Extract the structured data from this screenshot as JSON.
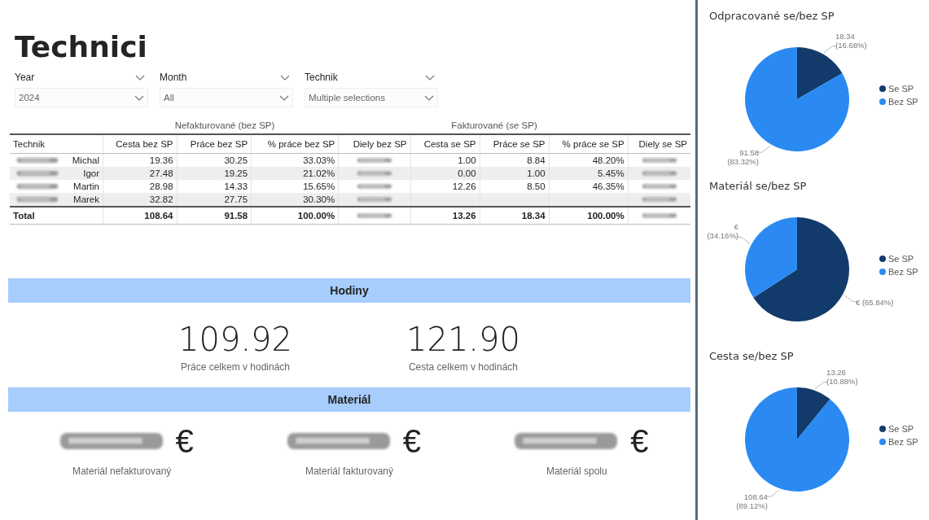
{
  "title": "Technici",
  "filters": [
    {
      "label": "Year",
      "value": "2024"
    },
    {
      "label": "Month",
      "value": "All"
    },
    {
      "label": "Technik",
      "value": "Multiple selections"
    }
  ],
  "table": {
    "groups": [
      "Nefakturované (bez SP)",
      "Fakturované (se SP)"
    ],
    "columns": [
      "Technik",
      "Cesta bez SP",
      "Práce bez SP",
      "% práce bez SP",
      "Diely bez SP",
      "Cesta se SP",
      "Práce se SP",
      "% práce se SP",
      "Diely se SP"
    ],
    "rows": [
      {
        "cells": [
          {
            "kind": "name",
            "text": "Michal"
          },
          {
            "kind": "text",
            "text": "19.36"
          },
          {
            "kind": "text",
            "text": "30.25"
          },
          {
            "kind": "text",
            "text": "33.03%"
          },
          {
            "kind": "blurred"
          },
          {
            "kind": "text",
            "text": "1.00"
          },
          {
            "kind": "text",
            "text": "8.84"
          },
          {
            "kind": "text",
            "text": "48.20%"
          },
          {
            "kind": "blurred"
          }
        ]
      },
      {
        "cells": [
          {
            "kind": "name",
            "text": "Igor"
          },
          {
            "kind": "text",
            "text": "27.48"
          },
          {
            "kind": "text",
            "text": "19.25"
          },
          {
            "kind": "text",
            "text": "21.02%"
          },
          {
            "kind": "blurred"
          },
          {
            "kind": "text",
            "text": "0.00"
          },
          {
            "kind": "text",
            "text": "1.00"
          },
          {
            "kind": "text",
            "text": "5.45%"
          },
          {
            "kind": "blurred"
          }
        ]
      },
      {
        "cells": [
          {
            "kind": "name",
            "text": "Martin"
          },
          {
            "kind": "text",
            "text": "28.98"
          },
          {
            "kind": "text",
            "text": "14.33"
          },
          {
            "kind": "text",
            "text": "15.65%"
          },
          {
            "kind": "blurred"
          },
          {
            "kind": "text",
            "text": "12.26"
          },
          {
            "kind": "text",
            "text": "8.50"
          },
          {
            "kind": "text",
            "text": "46.35%"
          },
          {
            "kind": "blurred"
          }
        ]
      },
      {
        "cells": [
          {
            "kind": "name",
            "text": "Marek"
          },
          {
            "kind": "text",
            "text": "32.82"
          },
          {
            "kind": "text",
            "text": "27.75"
          },
          {
            "kind": "text",
            "text": "30.30%"
          },
          {
            "kind": "blurred"
          },
          {
            "kind": "empty"
          },
          {
            "kind": "empty"
          },
          {
            "kind": "empty"
          },
          {
            "kind": "blurred"
          }
        ]
      }
    ],
    "total": [
      {
        "kind": "text",
        "text": "Total"
      },
      {
        "kind": "text",
        "text": "108.64"
      },
      {
        "kind": "text",
        "text": "91.58"
      },
      {
        "kind": "text",
        "text": "100.00%"
      },
      {
        "kind": "blurred"
      },
      {
        "kind": "text",
        "text": "13.26"
      },
      {
        "kind": "text",
        "text": "18.34"
      },
      {
        "kind": "text",
        "text": "100.00%"
      },
      {
        "kind": "blurred"
      }
    ]
  },
  "hours": {
    "header": "Hodiny",
    "kpis": [
      {
        "value": "109.92",
        "caption": "Práce celkem v hodinách"
      },
      {
        "value": "121.90",
        "caption": "Cesta celkem v hodinách"
      }
    ]
  },
  "material": {
    "header": "Materiál",
    "kpis": [
      {
        "currency": "€",
        "caption": "Materiál nefakturovaný"
      },
      {
        "currency": "€",
        "caption": "Materiál fakturovaný"
      },
      {
        "currency": "€",
        "caption": "Materiál spolu"
      }
    ]
  },
  "charts": [
    {
      "chart_data": {
        "type": "pie",
        "title": "Odpracované se/bez SP",
        "categories": [
          "Se SP",
          "Bez SP"
        ],
        "values": [
          16.68,
          83.32
        ],
        "legend": "right",
        "colors": [
          "#123a6b",
          "#2a8af2"
        ],
        "data_labels": "value_labels",
        "value_labels": [
          [
            "18.34",
            "(16.68%)"
          ],
          [
            "91.58",
            "(83.32%)"
          ]
        ]
      }
    },
    {
      "chart_data": {
        "type": "pie",
        "title": "Materiál se/bez SP",
        "categories": [
          "Se SP",
          "Bez SP"
        ],
        "values": [
          65.84,
          34.16
        ],
        "legend": "right",
        "colors": [
          "#123a6b",
          "#2a8af2"
        ],
        "data_labels": "value_labels",
        "value_labels": [
          [
            "€ (65.84%)"
          ],
          [
            "€",
            "(34.16%)"
          ]
        ]
      }
    },
    {
      "chart_data": {
        "type": "pie",
        "title": "Cesta se/bez SP",
        "categories": [
          "Se SP",
          "Bez SP"
        ],
        "values": [
          10.88,
          89.12
        ],
        "legend": "right",
        "colors": [
          "#123a6b",
          "#2a8af2"
        ],
        "data_labels": "value_labels",
        "value_labels": [
          [
            "13.26",
            "(10.88%)"
          ],
          [
            "108.64",
            "(89.12%)"
          ]
        ]
      }
    }
  ]
}
